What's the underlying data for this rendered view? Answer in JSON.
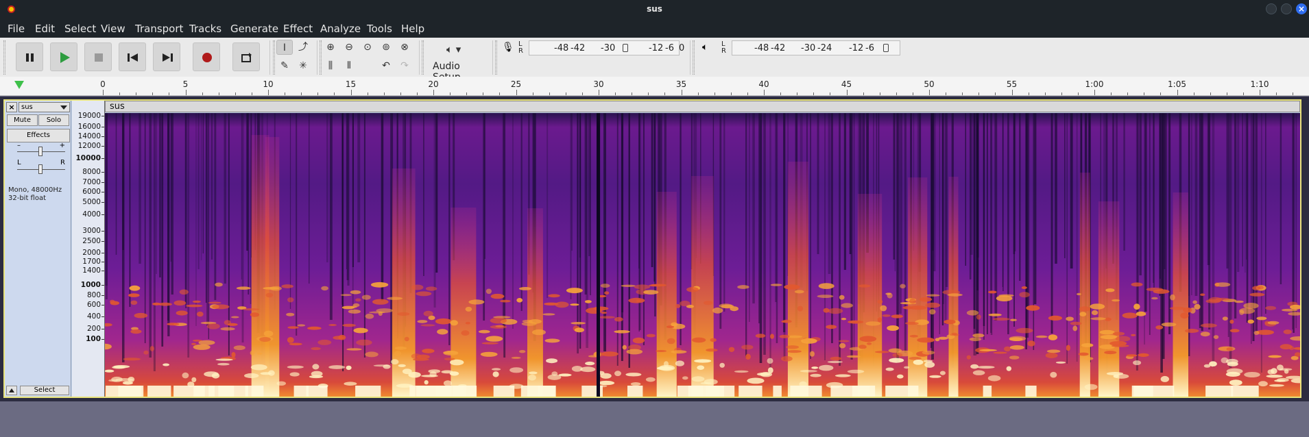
{
  "window": {
    "title": "sus"
  },
  "menu": [
    "File",
    "Edit",
    "Select",
    "View",
    "Transport",
    "Tracks",
    "Generate",
    "Effect",
    "Analyze",
    "Tools",
    "Help"
  ],
  "toolbar": {
    "audio_setup_label": "Audio Setup",
    "record_meter": {
      "lr": "L\nR",
      "scale": [
        "-48",
        "-42",
        "-30",
        "-18",
        "-12",
        "-6",
        "0"
      ]
    },
    "play_meter": {
      "lr": "L\nR",
      "scale": [
        "-48",
        "-42",
        "-30",
        "-24",
        "-12",
        "-6"
      ]
    }
  },
  "ruler": {
    "labels": [
      "0",
      "5",
      "10",
      "15",
      "20",
      "25",
      "30",
      "35",
      "40",
      "45",
      "50",
      "55",
      "1:00",
      "1:05",
      "1:10"
    ]
  },
  "track": {
    "name": "sus",
    "close": "×",
    "mute": "Mute",
    "solo": "Solo",
    "effects": "Effects",
    "gain_minus": "–",
    "gain_plus": "+",
    "pan_l": "L",
    "pan_r": "R",
    "info_line1": "Mono, 48000Hz",
    "info_line2": "32-bit float",
    "select": "Select",
    "clip_name": "sus",
    "freq_labels": [
      {
        "t": "19000",
        "b": false
      },
      {
        "t": "16000",
        "b": false
      },
      {
        "t": "14000",
        "b": false
      },
      {
        "t": "12000",
        "b": false
      },
      {
        "t": "10000",
        "b": true
      },
      {
        "t": "8000",
        "b": false
      },
      {
        "t": "7000",
        "b": false
      },
      {
        "t": "6000",
        "b": false
      },
      {
        "t": "5000",
        "b": false
      },
      {
        "t": "4000",
        "b": false
      },
      {
        "t": "3000",
        "b": false
      },
      {
        "t": "2500",
        "b": false
      },
      {
        "t": "2000",
        "b": false
      },
      {
        "t": "1700",
        "b": false
      },
      {
        "t": "1400",
        "b": false
      },
      {
        "t": "1000",
        "b": true
      },
      {
        "t": "800",
        "b": false
      },
      {
        "t": "600",
        "b": false
      },
      {
        "t": "400",
        "b": false
      },
      {
        "t": "200",
        "b": false
      },
      {
        "t": "100",
        "b": true
      }
    ]
  },
  "colors": {
    "spectro_low": "#160b2e",
    "spectro_mid": "#8a1fa0",
    "spectro_high": "#f07a1a",
    "spectro_peak": "#fff6d0",
    "selection_border": "#e8e37a"
  }
}
